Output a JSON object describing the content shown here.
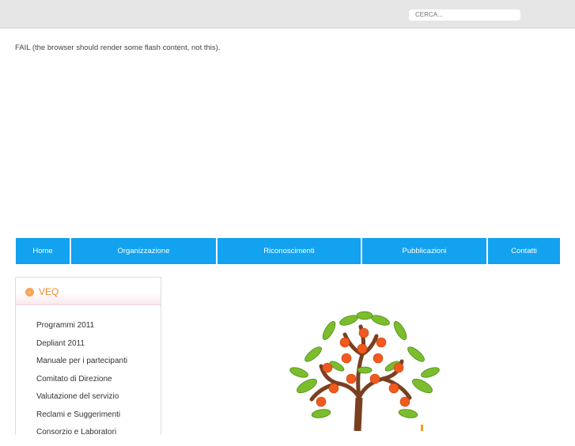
{
  "search": {
    "placeholder": "CERCA..."
  },
  "flash": {
    "message": "FAIL (the browser should render some flash content, not this)."
  },
  "nav": {
    "items": [
      {
        "label": "Home"
      },
      {
        "label": "Organizzazione"
      },
      {
        "label": "Riconoscimenti"
      },
      {
        "label": "Pubblicazioni"
      },
      {
        "label": "Contatti"
      }
    ]
  },
  "sidebar": {
    "title": "VEQ",
    "items": [
      {
        "label": "Programmi 2011"
      },
      {
        "label": "Depliant 2011"
      },
      {
        "label": "Manuale per i partecipanti"
      },
      {
        "label": "Comitato di Direzione"
      },
      {
        "label": "Valutazione del servizio"
      },
      {
        "label": "Reclami e Suggerimenti"
      },
      {
        "label": "Consorzio e Laboratori"
      }
    ]
  },
  "colors": {
    "nav": "#12a2f0",
    "accent": "#f08a2c",
    "topbar": "#e6e6e6"
  }
}
